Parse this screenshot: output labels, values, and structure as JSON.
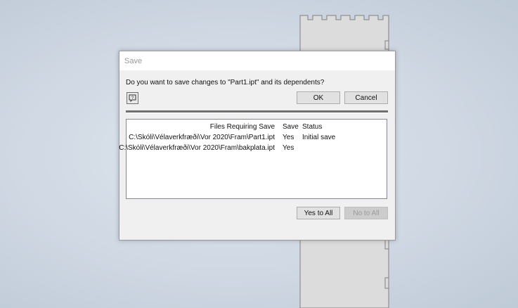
{
  "dialog": {
    "title": "Save",
    "question": "Do you want to save changes to \"Part1.ipt\" and its dependents?",
    "ok_label": "OK",
    "cancel_label": "Cancel",
    "help_icon": "help-question-icon",
    "columns": {
      "file": "Files Requiring Save",
      "save": "Save",
      "status": "Status"
    },
    "rows": [
      {
        "file": "C:\\Skóli\\Vélaverkfræði\\Vor 2020\\Fram\\Part1.ipt",
        "save": "Yes",
        "status": "Initial save"
      },
      {
        "file": "C:\\Skóli\\Vélaverkfræði\\Vor 2020\\Fram\\bakplata.ipt",
        "save": "Yes",
        "status": ""
      }
    ],
    "yes_to_all_label": "Yes to All",
    "no_to_all_label": "No to All"
  },
  "colors": {
    "background": "#cfd8e3",
    "part_face": "#dcdcdc",
    "part_edge": "#808080",
    "dialog_bg": "#f0f0f0",
    "button_bg": "#e1e1e1"
  }
}
